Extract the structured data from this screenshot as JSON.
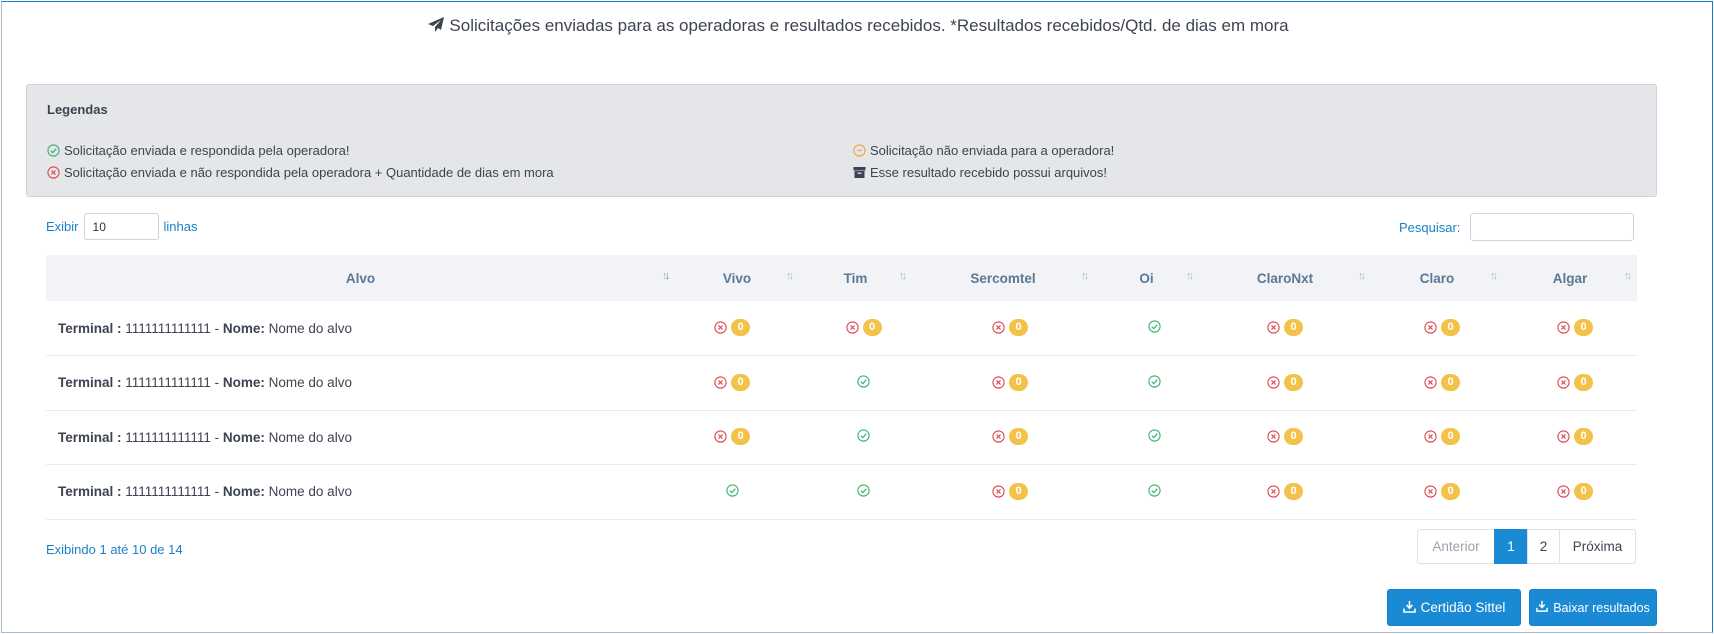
{
  "header": {
    "title": "Solicitações enviadas para as operadoras e resultados recebidos. *Resultados recebidos/Qtd. de dias em mora",
    "icon": "paper-plane-icon"
  },
  "legend": {
    "title": "Legendas",
    "items": [
      {
        "icon": "check-circle-icon",
        "color": "#3cb371",
        "text": "Solicitação enviada e respondida pela operadora!"
      },
      {
        "icon": "x-circle-icon",
        "color": "#e0454f",
        "text": "Solicitação enviada e não respondida pela operadora + Quantidade de dias em mora"
      },
      {
        "icon": "minus-circle-icon",
        "color": "#f0a53a",
        "text": "Solicitação não enviada para a operadora!"
      },
      {
        "icon": "archive-icon",
        "color": "#3d4451",
        "text": "Esse resultado recebido possui arquivos!"
      }
    ]
  },
  "controls": {
    "show_label": "Exibir",
    "show_value": "10",
    "rows_label": "linhas",
    "search_label": "Pesquisar:",
    "search_value": ""
  },
  "table": {
    "columns": [
      "Alvo",
      "Vivo",
      "Tim",
      "Sercomtel",
      "Oi",
      "ClaroNxt",
      "Claro",
      "Algar"
    ],
    "rows": [
      {
        "terminal_label": "Terminal :",
        "terminal": "1111111111111",
        "sep": " - ",
        "nome_label": "Nome:",
        "nome": "Nome do alvo",
        "cells": [
          {
            "s": "x",
            "n": "0"
          },
          {
            "s": "x",
            "n": "0"
          },
          {
            "s": "x",
            "n": "0"
          },
          {
            "s": "ok"
          },
          {
            "s": "x",
            "n": "0"
          },
          {
            "s": "x",
            "n": "0"
          },
          {
            "s": "x",
            "n": "0"
          }
        ]
      },
      {
        "terminal_label": "Terminal :",
        "terminal": "1111111111111",
        "sep": " - ",
        "nome_label": "Nome:",
        "nome": "Nome do alvo",
        "cells": [
          {
            "s": "x",
            "n": "0"
          },
          {
            "s": "ok"
          },
          {
            "s": "x",
            "n": "0"
          },
          {
            "s": "ok"
          },
          {
            "s": "x",
            "n": "0"
          },
          {
            "s": "x",
            "n": "0"
          },
          {
            "s": "x",
            "n": "0"
          }
        ]
      },
      {
        "terminal_label": "Terminal :",
        "terminal": "1111111111111",
        "sep": " - ",
        "nome_label": "Nome:",
        "nome": "Nome do alvo",
        "cells": [
          {
            "s": "x",
            "n": "0"
          },
          {
            "s": "ok"
          },
          {
            "s": "x",
            "n": "0"
          },
          {
            "s": "ok"
          },
          {
            "s": "x",
            "n": "0"
          },
          {
            "s": "x",
            "n": "0"
          },
          {
            "s": "x",
            "n": "0"
          }
        ]
      },
      {
        "terminal_label": "Terminal :",
        "terminal": "1111111111111",
        "sep": " - ",
        "nome_label": "Nome:",
        "nome": "Nome do alvo",
        "cells": [
          {
            "s": "ok"
          },
          {
            "s": "ok"
          },
          {
            "s": "x",
            "n": "0"
          },
          {
            "s": "ok"
          },
          {
            "s": "x",
            "n": "0"
          },
          {
            "s": "x",
            "n": "0"
          },
          {
            "s": "x",
            "n": "0"
          }
        ]
      }
    ]
  },
  "footer": {
    "info": "Exibindo 1 até 10 de 14",
    "pagination": {
      "prev": "Anterior",
      "pages": [
        "1",
        "2"
      ],
      "active": "1",
      "next": "Próxima"
    }
  },
  "buttons": {
    "certidao": "Certidão Sittel",
    "baixar": "Baixar resultados"
  },
  "colors": {
    "accent": "#1a8ad4",
    "ok": "#3cb371",
    "error": "#e0454f",
    "warning_badge": "#f3c24a"
  }
}
